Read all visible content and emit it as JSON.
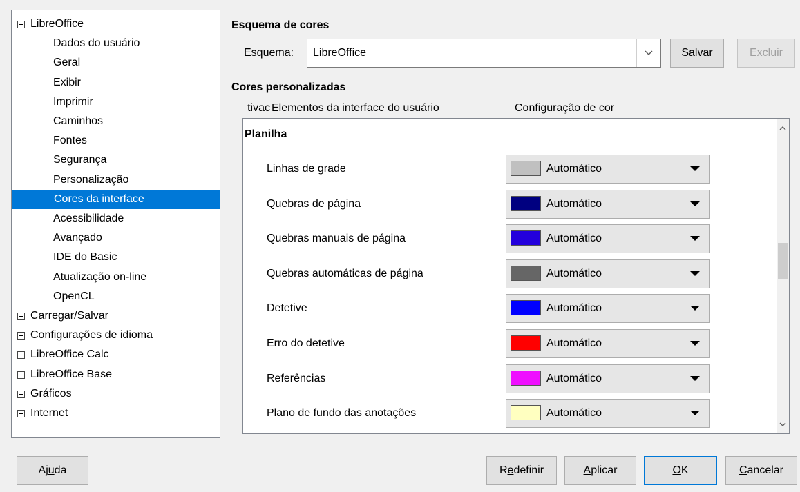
{
  "tree": {
    "items": [
      {
        "label": "LibreOffice",
        "level": 0,
        "expander": "minus",
        "selected": false
      },
      {
        "label": "Dados do usuário",
        "level": 1,
        "expander": null,
        "selected": false
      },
      {
        "label": "Geral",
        "level": 1,
        "expander": null,
        "selected": false
      },
      {
        "label": "Exibir",
        "level": 1,
        "expander": null,
        "selected": false
      },
      {
        "label": "Imprimir",
        "level": 1,
        "expander": null,
        "selected": false
      },
      {
        "label": "Caminhos",
        "level": 1,
        "expander": null,
        "selected": false
      },
      {
        "label": "Fontes",
        "level": 1,
        "expander": null,
        "selected": false
      },
      {
        "label": "Segurança",
        "level": 1,
        "expander": null,
        "selected": false
      },
      {
        "label": "Personalização",
        "level": 1,
        "expander": null,
        "selected": false
      },
      {
        "label": "Cores da interface",
        "level": 1,
        "expander": null,
        "selected": true
      },
      {
        "label": "Acessibilidade",
        "level": 1,
        "expander": null,
        "selected": false
      },
      {
        "label": "Avançado",
        "level": 1,
        "expander": null,
        "selected": false
      },
      {
        "label": "IDE do Basic",
        "level": 1,
        "expander": null,
        "selected": false
      },
      {
        "label": "Atualização on-line",
        "level": 1,
        "expander": null,
        "selected": false
      },
      {
        "label": "OpenCL",
        "level": 1,
        "expander": null,
        "selected": false
      },
      {
        "label": "Carregar/Salvar",
        "level": 0,
        "expander": "plus",
        "selected": false
      },
      {
        "label": "Configurações de idioma",
        "level": 0,
        "expander": "plus",
        "selected": false
      },
      {
        "label": "LibreOffice Calc",
        "level": 0,
        "expander": "plus",
        "selected": false
      },
      {
        "label": "LibreOffice Base",
        "level": 0,
        "expander": "plus",
        "selected": false
      },
      {
        "label": "Gráficos",
        "level": 0,
        "expander": "plus",
        "selected": false
      },
      {
        "label": "Internet",
        "level": 0,
        "expander": "plus",
        "selected": false
      }
    ]
  },
  "scheme": {
    "section_title": "Esquema de cores",
    "label_pre": "Esque",
    "label_mnemonic": "m",
    "label_post": "a:",
    "value": "LibreOffice",
    "save": {
      "mnemonic": "S",
      "rest": "alvar"
    },
    "delete": {
      "pre": "E",
      "mnemonic": "x",
      "rest": "cluir"
    }
  },
  "custom": {
    "section_title": "Cores personalizadas",
    "col_active": "tivac",
    "col_elements": "Elementos da interface do usuário",
    "col_color": "Configuração de cor",
    "group": "Planilha",
    "rows": [
      {
        "label": "Linhas de grade",
        "color": "#c0c0c0",
        "value": "Automático"
      },
      {
        "label": "Quebras de página",
        "color": "#000080",
        "value": "Automático"
      },
      {
        "label": "Quebras manuais de página",
        "color": "#2300dc",
        "value": "Automático"
      },
      {
        "label": "Quebras automáticas de página",
        "color": "#666666",
        "value": "Automático"
      },
      {
        "label": "Detetive",
        "color": "#0000ff",
        "value": "Automático"
      },
      {
        "label": "Erro do detetive",
        "color": "#ff0000",
        "value": "Automático"
      },
      {
        "label": "Referências",
        "color": "#ef0fff",
        "value": "Automático"
      },
      {
        "label": "Plano de fundo das anotações",
        "color": "#ffffc0",
        "value": "Automático"
      }
    ]
  },
  "footer": {
    "help": {
      "pre": "Aj",
      "mnemonic": "u",
      "rest": "da"
    },
    "reset": {
      "pre": "R",
      "mnemonic": "e",
      "rest": "definir"
    },
    "apply": {
      "pre": "",
      "mnemonic": "A",
      "rest": "plicar"
    },
    "ok": {
      "pre": "",
      "mnemonic": "O",
      "rest": "K"
    },
    "cancel": {
      "pre": "",
      "mnemonic": "C",
      "rest": "ancelar"
    }
  }
}
